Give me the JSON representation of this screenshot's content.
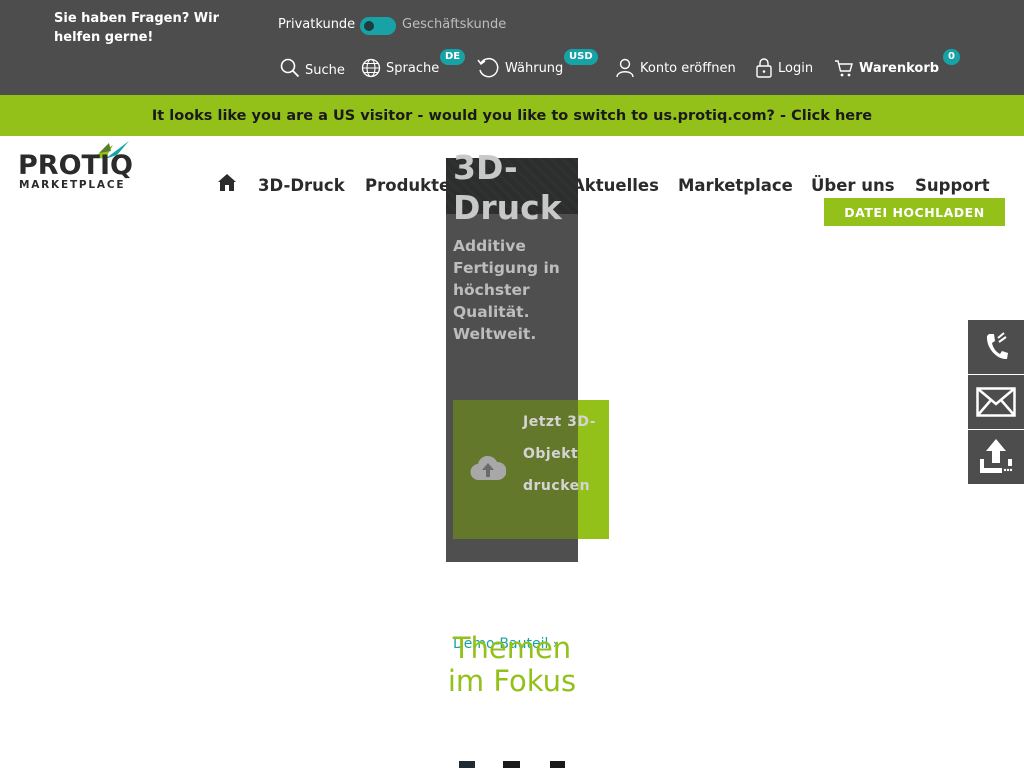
{
  "topbar": {
    "help_text": "Sie haben Fragen? Wir helfen gerne!",
    "toggle": {
      "left_label": "Privatkunde",
      "right_label": "Geschäftskunde",
      "state": "Privatkunde"
    },
    "utilities": {
      "search": {
        "label": "Suche",
        "icon": "search-icon"
      },
      "language": {
        "label": "Sprache",
        "badge": "DE",
        "icon": "globe-icon"
      },
      "currency": {
        "label": "Währung",
        "badge": "USD",
        "icon": "refresh-icon"
      },
      "account": {
        "label": "Konto eröffnen",
        "icon": "user-icon"
      },
      "login": {
        "label": "Login",
        "icon": "lock-icon"
      },
      "cart": {
        "label": "Warenkorb",
        "badge": "0",
        "icon": "cart-icon"
      }
    }
  },
  "banner": {
    "text": "It looks like you are a US visitor - would you like to switch to us.protiq.com? - Click here"
  },
  "logo": {
    "brand": "PROTIQ",
    "sub": "MARKETPLACE"
  },
  "nav": {
    "home_icon": "home-icon",
    "items": [
      "3D-Druck",
      "Produkte & Services",
      "Aktuelles",
      "Marketplace",
      "Über uns",
      "Support"
    ],
    "upload_label": "DATEI HOCHLADEN"
  },
  "hero": {
    "title": "3D-Druck",
    "subtitle": "Additive Fertigung in höchster Qualität. Weltweit.",
    "cta": "Jetzt 3D-Objekt drucken",
    "cta_icon": "cloud-upload-icon"
  },
  "side_actions": [
    {
      "name": "phone-icon"
    },
    {
      "name": "mail-icon"
    },
    {
      "name": "upload-icon"
    }
  ],
  "themes": {
    "demo_link": "Demo-Bauteil",
    "title": "Themen im Fokus"
  },
  "colors": {
    "topbar": "#4d4d4d",
    "accent_green": "#94c01a",
    "teal": "#17a2a6"
  }
}
